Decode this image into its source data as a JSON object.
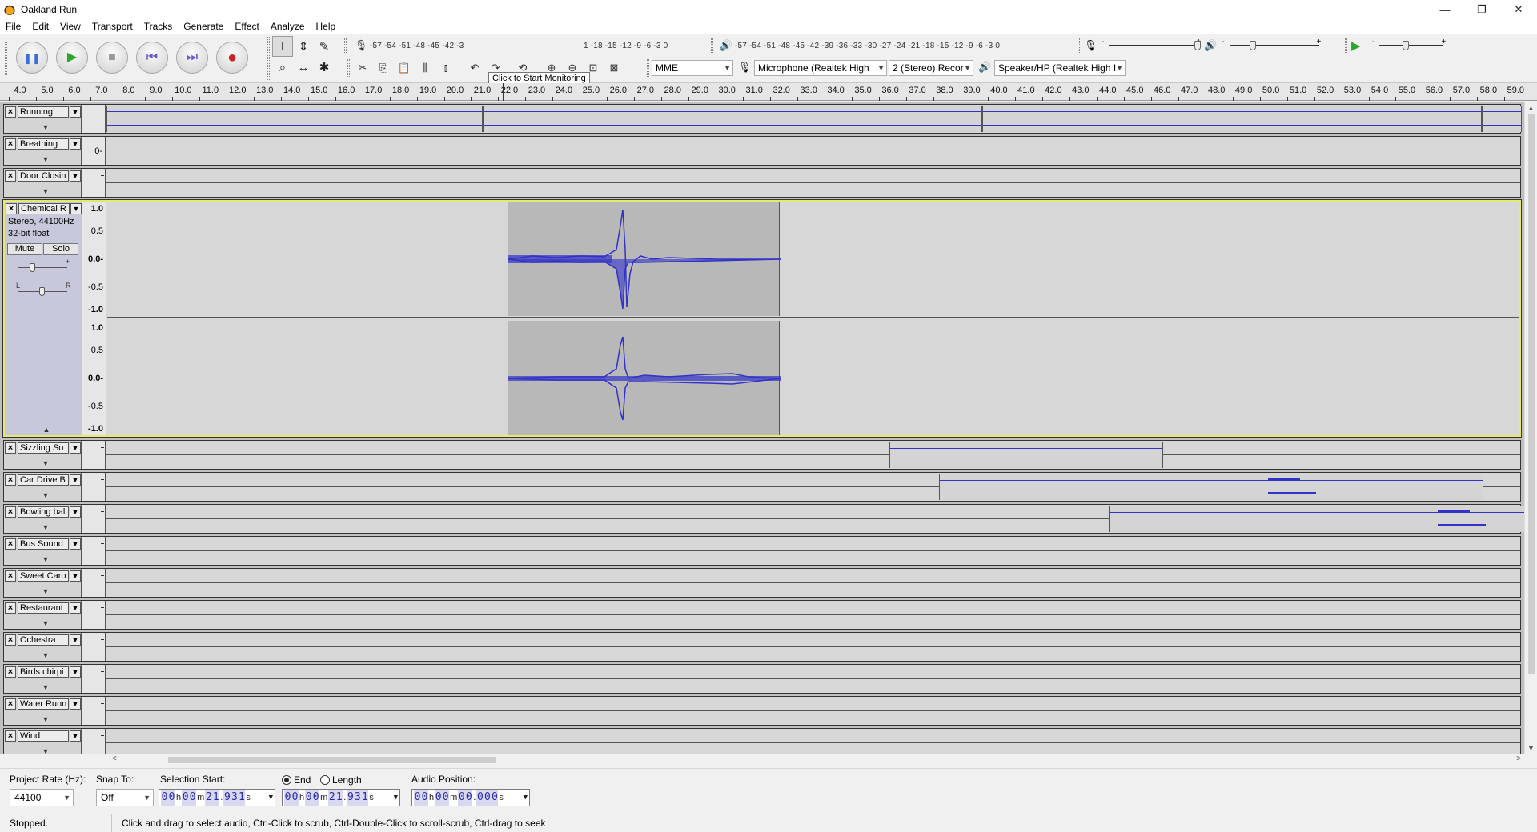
{
  "window": {
    "title": "Oakland Run",
    "minimize": "—",
    "restore": "❐",
    "close": "✕"
  },
  "menu": [
    "File",
    "Edit",
    "View",
    "Transport",
    "Tracks",
    "Generate",
    "Effect",
    "Analyze",
    "Help"
  ],
  "transport": {
    "pause": "❚❚",
    "play": "▶",
    "stop": "■",
    "skip_start": "⏮",
    "skip_end": "⏭",
    "record": "●",
    "colors": {
      "pause": "#3a6fd8",
      "play": "#2aa82a",
      "stop": "#999999",
      "skip": "#6a5acd",
      "record": "#cc2222"
    }
  },
  "tools": [
    "I",
    "⇕",
    "✎",
    "⌕",
    "↔",
    "✱"
  ],
  "meters": {
    "record_ticks": "-57 -54 -51 -48 -45 -42 -3",
    "record_ticks_after": "1 -18 -15 -12  -9  -6  -3  0",
    "tooltip": "Click to Start Monitoring",
    "play_ticks": "-57 -54 -51 -48 -45 -42 -39 -36 -33 -30 -27 -24 -21 -18 -15 -12  -9  -6  -3  0"
  },
  "mixer": {
    "minus": "-",
    "plus": "+"
  },
  "edit_tools": [
    "✂",
    "⎘",
    "📋",
    "⫼",
    "⫾",
    "↶",
    "↷",
    "⟲",
    "⊕",
    "⊖",
    "⊡",
    "⊠"
  ],
  "devices": {
    "host": "MME",
    "recording_device": "Microphone (Realtek High",
    "channels": "2 (Stereo) Recor",
    "playback_device": "Speaker/HP (Realtek High I"
  },
  "ruler": [
    "4.0",
    "5.0",
    "6.0",
    "7.0",
    "8.0",
    "9.0",
    "10.0",
    "11.0",
    "12.0",
    "13.0",
    "14.0",
    "15.0",
    "16.0",
    "17.0",
    "18.0",
    "19.0",
    "20.0",
    "21.0",
    "22.0",
    "23.0",
    "24.0",
    "25.0",
    "26.0",
    "27.0",
    "28.0",
    "29.0",
    "30.0",
    "31.0",
    "32.0",
    "33.0",
    "34.0",
    "35.0",
    "36.0",
    "37.0",
    "38.0",
    "39.0",
    "40.0",
    "41.0",
    "42.0",
    "43.0",
    "44.0",
    "45.0",
    "46.0",
    "47.0",
    "48.0",
    "49.0",
    "50.0",
    "51.0",
    "52.0",
    "53.0",
    "54.0",
    "55.0",
    "56.0",
    "57.0",
    "58.0",
    "59.0"
  ],
  "tracks": [
    {
      "name": "Running"
    },
    {
      "name": "Breathing",
      "vlabel": "0-"
    },
    {
      "name": "Door Closin"
    },
    {
      "name": "Chemical R",
      "info1": "Stereo, 44100Hz",
      "info2": "32-bit float",
      "mute": "Mute",
      "solo": "Solo",
      "gain_minus": "-",
      "gain_plus": "+",
      "pan_left": "L",
      "pan_right": "R",
      "scale": [
        "1.0",
        "0.5",
        "0.0-",
        "-0.5",
        "-1.0"
      ]
    },
    {
      "name": "Sizzling So"
    },
    {
      "name": "Car Drive B"
    },
    {
      "name": "Bowling ball"
    },
    {
      "name": "Bus Sound"
    },
    {
      "name": "Sweet Caro"
    },
    {
      "name": "Restaurant"
    },
    {
      "name": "Ochestra"
    },
    {
      "name": "Birds chirpi"
    },
    {
      "name": "Water Runn"
    },
    {
      "name": "Wind"
    }
  ],
  "selection": {
    "project_rate_label": "Project Rate (Hz):",
    "project_rate": "44100",
    "snap_label": "Snap To:",
    "snap": "Off",
    "start_label": "Selection Start:",
    "end_label": "End",
    "length_label": "Length",
    "audio_pos_label": "Audio Position:",
    "start_time": [
      "0",
      "0",
      "h",
      "0",
      "0",
      "m",
      "2",
      "1",
      ".",
      "9",
      "3",
      "1",
      "s"
    ],
    "end_time": [
      "0",
      "0",
      "h",
      "0",
      "0",
      "m",
      "2",
      "1",
      ".",
      "9",
      "3",
      "1",
      "s"
    ],
    "audio_time": [
      "0",
      "0",
      "h",
      "0",
      "0",
      "m",
      "0",
      "0",
      ".",
      "0",
      "0",
      "0",
      "s"
    ]
  },
  "status": {
    "state": "Stopped.",
    "hint": "Click and drag to select audio, Ctrl-Click to scrub, Ctrl-Double-Click to scroll-scrub, Ctrl-drag to seek"
  }
}
